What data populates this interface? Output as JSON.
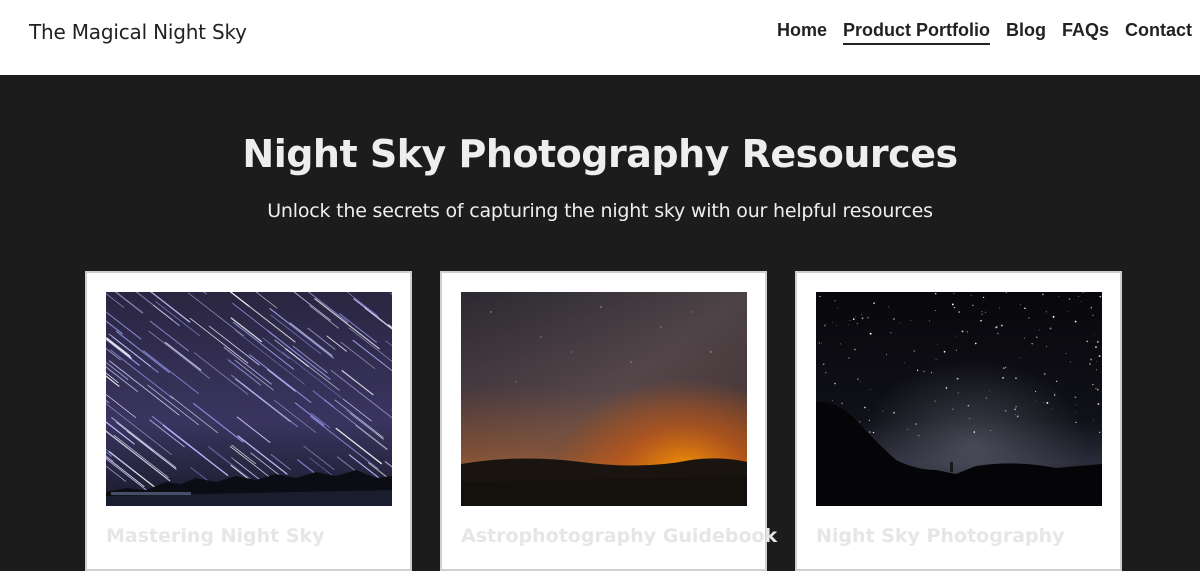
{
  "header": {
    "site_title": "The Magical Night Sky",
    "nav": [
      {
        "label": "Home",
        "active": false
      },
      {
        "label": "Product Portfolio",
        "active": true
      },
      {
        "label": "Blog",
        "active": false
      },
      {
        "label": "FAQs",
        "active": false
      },
      {
        "label": "Contact",
        "active": false
      }
    ]
  },
  "hero": {
    "title": "Night Sky Photography Resources",
    "subtitle": "Unlock the secrets of capturing the night sky with our helpful resources"
  },
  "cards": [
    {
      "title": "Mastering Night Sky",
      "image": "star-trails-photo"
    },
    {
      "title": "Astrophotography Guidebook",
      "image": "milky-way-sunset-photo"
    },
    {
      "title": "Night Sky Photography",
      "image": "starry-night-hills-photo"
    }
  ],
  "colors": {
    "header_bg": "#ffffff",
    "hero_bg": "#1c1c1c",
    "text_light": "#eeeeee",
    "text_dark": "#222222"
  }
}
